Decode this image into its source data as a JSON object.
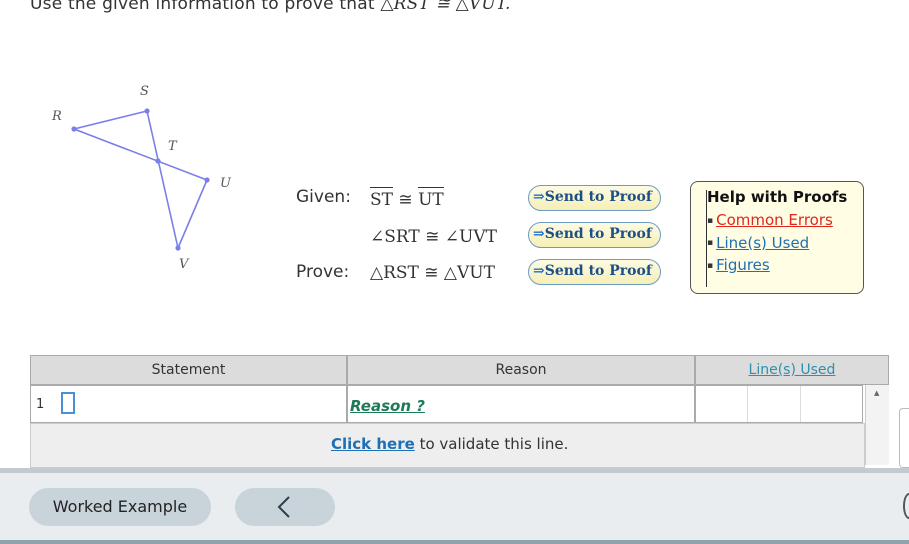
{
  "instruction": {
    "text": "Use the given information to prove that ",
    "math": "△RST ≅ △VUT."
  },
  "figure": {
    "labels": {
      "R": "R",
      "S": "S",
      "T": "T",
      "U": "U",
      "V": "V"
    },
    "line_color": "#7b7fe8"
  },
  "given": {
    "label": "Given:",
    "stmt1_left": "ST",
    "stmt1_op": " ≅ ",
    "stmt1_right": "UT",
    "stmt2": "∠SRT ≅ ∠UVT"
  },
  "prove": {
    "label": "Prove:",
    "stmt": "△RST ≅ △VUT"
  },
  "send_button": {
    "arrow": "⇒",
    "label": "Send to Proof"
  },
  "help": {
    "title": "Help with Proofs",
    "links": [
      {
        "label": "Common Errors",
        "color": "#e0261b"
      },
      {
        "label": "Line(s) Used",
        "color": "#1f6fb5"
      },
      {
        "label": "Figures",
        "color": "#1f6fb5"
      }
    ]
  },
  "table": {
    "headers": {
      "statement": "Statement",
      "reason": "Reason",
      "lines_used": "Line(s) Used"
    },
    "rows": [
      {
        "number": "1",
        "reason_placeholder": "Reason ?"
      }
    ],
    "validate": {
      "link": "Click here",
      "text": " to validate this line."
    }
  },
  "footer": {
    "worked_example": "Worked Example",
    "back_icon": "chevron-left-icon"
  }
}
